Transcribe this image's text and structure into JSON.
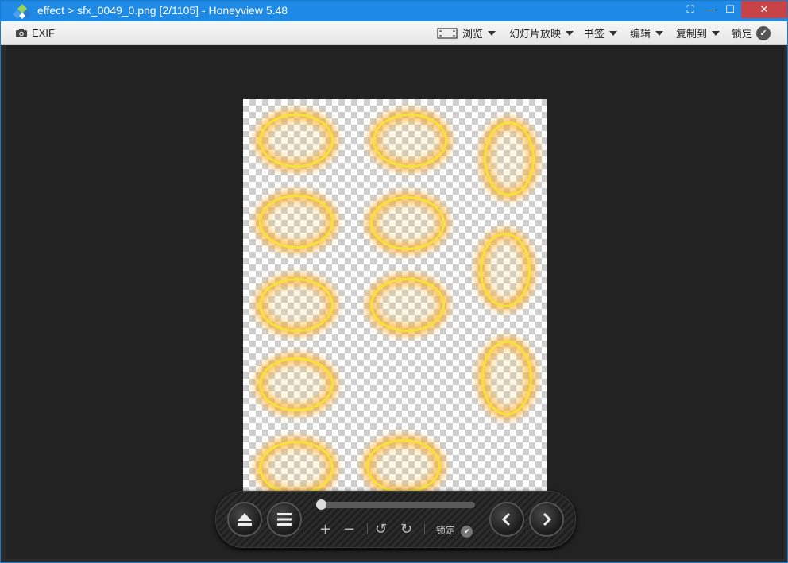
{
  "window": {
    "title": "effect > sfx_0049_0.png [2/1105] - Honeyview 5.48",
    "buttons": {
      "fullscreen": "⛶",
      "minimize": "—",
      "maximize": "☐",
      "close": "✕"
    }
  },
  "toolbar": {
    "exif_label": "EXIF",
    "browse_label": "浏览",
    "slideshow_label": "幻灯片放映",
    "bookmark_label": "书签",
    "edit_label": "编辑",
    "copy_to_label": "复制到",
    "lock_label": "锁定"
  },
  "controls": {
    "zoom_in": "+",
    "zoom_out": "−",
    "rotate_left": "↺",
    "rotate_right": "↻",
    "lock_label": "锁定",
    "position_fraction": 0.002
  },
  "colors": {
    "titlebar": "#1e8ae6",
    "close": "#c74345",
    "glow": "#f2e23a"
  },
  "icons": [
    "app-logo-icon",
    "camera-icon",
    "fullscreen-icon",
    "check-icon",
    "eject-icon",
    "menu-icon",
    "prev-arrow-icon",
    "next-arrow-icon"
  ]
}
